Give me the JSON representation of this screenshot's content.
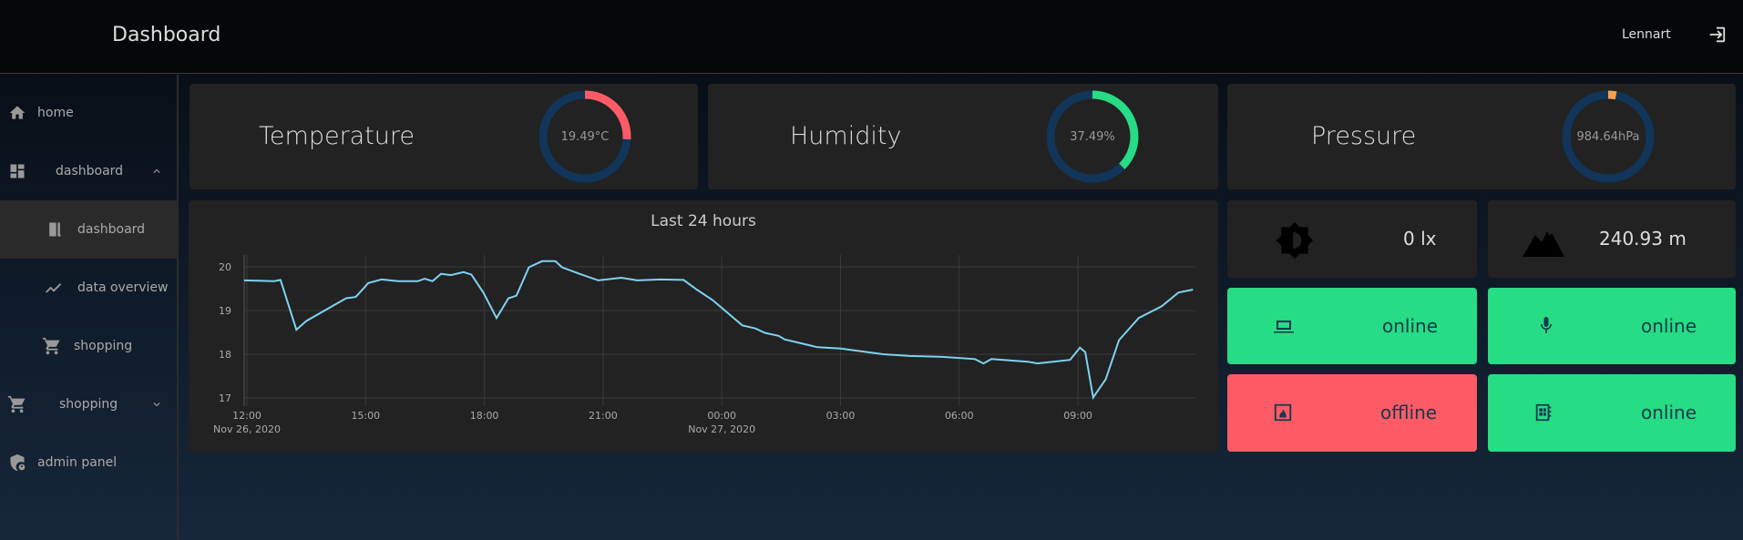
{
  "header": {
    "title": "Dashboard",
    "user": "Lennart",
    "logout_icon": "logout-icon"
  },
  "sidebar": {
    "items": [
      {
        "label": "home",
        "icon": "home-icon"
      },
      {
        "label": "dashboard",
        "icon": "dashboard-icon",
        "expanded": true
      },
      {
        "label": "dashboard",
        "icon": "door-icon",
        "active": true
      },
      {
        "label": "data overview",
        "icon": "trend-icon"
      },
      {
        "label": "shopping",
        "icon": "cart-icon"
      },
      {
        "label": "shopping",
        "icon": "cart-icon",
        "expanded": false
      },
      {
        "label": "admin panel",
        "icon": "shield-account-icon"
      }
    ]
  },
  "sensors": [
    {
      "name": "Temperature",
      "value": "19.49°C",
      "fraction": 0.26,
      "color": "#fe5b66"
    },
    {
      "name": "Humidity",
      "value": "37.49%",
      "fraction": 0.375,
      "color": "#26dc84"
    },
    {
      "name": "Pressure",
      "value": "984.64hPa",
      "fraction": 0.03,
      "color": "#f6a04d"
    }
  ],
  "gauge_track_color": "#12355a",
  "tiles": {
    "light": {
      "value": "0 lx",
      "icon": "brightness-icon"
    },
    "altitude": {
      "value": "240.93 m",
      "icon": "mountain-icon"
    },
    "devices": [
      {
        "icon": "laptop-icon",
        "status": "online",
        "color": "#26dc84"
      },
      {
        "icon": "microphone-icon",
        "status": "online",
        "color": "#26dc84"
      },
      {
        "icon": "fireplace-icon",
        "status": "offline",
        "color": "#fe5b66"
      },
      {
        "icon": "notebook-icon",
        "status": "online",
        "color": "#26dc84"
      }
    ]
  },
  "chart_data": {
    "type": "line",
    "title": "Last 24 hours",
    "xlabel": "",
    "ylabel": "",
    "ylim": [
      16.8,
      20.3
    ],
    "yticks": [
      "17",
      "18",
      "19",
      "20"
    ],
    "xticks": [
      "12:00",
      "15:00",
      "18:00",
      "21:00",
      "00:00",
      "03:00",
      "06:00",
      "09:00"
    ],
    "xdates": [
      "Nov 26, 2020",
      "Nov 27, 2020"
    ],
    "grid": true,
    "color": "#7dd3f0",
    "series": [
      {
        "x": [
          "2020-11-26T12:00",
          "2020-11-26T12:45",
          "2020-11-26T12:55",
          "2020-11-26T13:19",
          "2020-11-26T13:34",
          "2020-11-26T14:34",
          "2020-11-26T14:49",
          "2020-11-26T15:08",
          "2020-11-26T15:28",
          "2020-11-26T15:53",
          "2020-11-26T16:23",
          "2020-11-26T16:33",
          "2020-11-26T16:45",
          "2020-11-26T16:58",
          "2020-11-26T17:13",
          "2020-11-26T17:32",
          "2020-11-26T17:44",
          "2020-11-26T18:02",
          "2020-11-26T18:22",
          "2020-11-26T18:40",
          "2020-11-26T18:52",
          "2020-11-26T19:11",
          "2020-11-26T19:31",
          "2020-11-26T19:51",
          "2020-11-26T20:01",
          "2020-11-26T20:31",
          "2020-11-26T20:56",
          "2020-11-26T21:31",
          "2020-11-26T21:55",
          "2020-11-26T22:30",
          "2020-11-26T23:05",
          "2020-11-26T23:25",
          "2020-11-26T23:49",
          "2020-11-27T00:34",
          "2020-11-27T00:54",
          "2020-11-27T01:08",
          "2020-11-27T01:29",
          "2020-11-27T01:38",
          "2020-11-27T02:28",
          "2020-11-27T03:03",
          "2020-11-27T04:07",
          "2020-11-27T04:47",
          "2020-11-27T05:37",
          "2020-11-27T06:26",
          "2020-11-27T06:39",
          "2020-11-27T06:51",
          "2020-11-27T07:46",
          "2020-11-27T08:01",
          "2020-11-27T08:50",
          "2020-11-27T09:05",
          "2020-11-27T09:13",
          "2020-11-27T09:25",
          "2020-11-27T09:44",
          "2020-11-27T10:04",
          "2020-11-27T10:34",
          "2020-11-27T11:09",
          "2020-11-27T11:34",
          "2020-11-27T11:56"
        ],
        "y": [
          19.69,
          19.67,
          19.7,
          18.56,
          18.76,
          19.28,
          19.31,
          19.63,
          19.71,
          19.67,
          19.67,
          19.73,
          19.67,
          19.84,
          19.81,
          19.88,
          19.82,
          19.41,
          18.83,
          19.28,
          19.34,
          19.99,
          20.13,
          20.13,
          19.99,
          19.82,
          19.69,
          19.75,
          19.69,
          19.71,
          19.7,
          19.48,
          19.24,
          18.66,
          18.59,
          18.49,
          18.42,
          18.34,
          18.16,
          18.13,
          18.0,
          17.96,
          17.94,
          17.89,
          17.79,
          17.89,
          17.83,
          17.79,
          17.87,
          18.15,
          18.05,
          17.01,
          17.43,
          18.32,
          18.83,
          19.1,
          19.41,
          19.48
        ]
      }
    ]
  }
}
